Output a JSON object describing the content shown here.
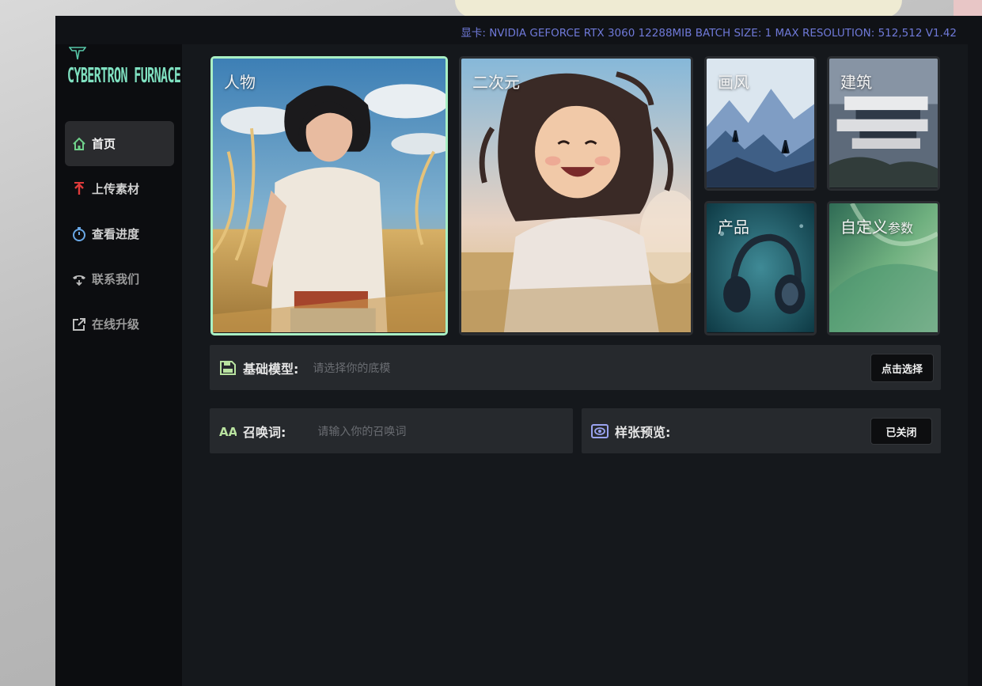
{
  "status_bar": {
    "text": "显卡:  NVIDIA GEFORCE RTX 3060 12288MIB  BATCH SIZE:  1  MAX RESOLUTION:  512,512 V1.42"
  },
  "brand": {
    "name": "CYBERTRON FURNACE",
    "color": "#7fe0c0"
  },
  "nav": {
    "items": [
      {
        "label": "首页",
        "icon": "home-icon",
        "active": true
      },
      {
        "label": "上传素材",
        "icon": "upload-arrow-icon"
      },
      {
        "label": "查看进度",
        "icon": "stopwatch-icon"
      },
      {
        "label": "联系我们",
        "icon": "phone-icon"
      },
      {
        "label": "在线升级",
        "icon": "external-link-icon"
      }
    ]
  },
  "categories": [
    {
      "label": "人物",
      "selected": true
    },
    {
      "label": "二次元"
    },
    {
      "label": "画风"
    },
    {
      "label": "建筑"
    },
    {
      "label": "产品"
    },
    {
      "label_main": "自定义",
      "label_small": "参数"
    }
  ],
  "base_model": {
    "label": "基础模型:",
    "placeholder": "请选择你的底模",
    "button": "点击选择",
    "icon": "save-disk-icon"
  },
  "prompt": {
    "label": "召唤词:",
    "placeholder": "请输入你的召唤词",
    "icon": "font-aa-icon"
  },
  "preview": {
    "label": "样张预览:",
    "button": "已关闭",
    "icon": "eye-icon"
  },
  "colors": {
    "accent_selected": "#a9f0c4",
    "status_text": "#6f79d8"
  }
}
